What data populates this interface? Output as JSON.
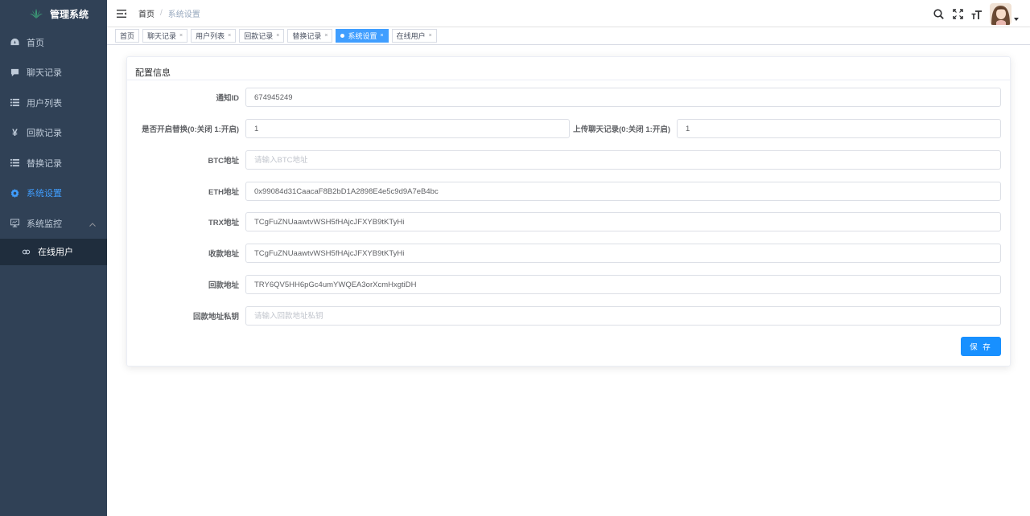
{
  "app": {
    "title": "管理系统"
  },
  "sidebar": {
    "items": [
      {
        "label": "首页",
        "icon": "dashboard-icon"
      },
      {
        "label": "聊天记录",
        "icon": "message-icon"
      },
      {
        "label": "用户列表",
        "icon": "list-icon"
      },
      {
        "label": "回款记录",
        "icon": "yen-icon"
      },
      {
        "label": "替换记录",
        "icon": "list-icon"
      },
      {
        "label": "系统设置",
        "icon": "gear-icon",
        "active": true
      },
      {
        "label": "系统监控",
        "icon": "monitor-icon",
        "expanded": true
      }
    ],
    "submenu": [
      {
        "label": "在线用户",
        "icon": "online-icon"
      }
    ]
  },
  "header": {
    "breadcrumb": {
      "home": "首页",
      "separator": "/",
      "current": "系统设置"
    }
  },
  "tags": [
    {
      "label": "首页",
      "closable": false
    },
    {
      "label": "聊天记录",
      "closable": true
    },
    {
      "label": "用户列表",
      "closable": true
    },
    {
      "label": "回款记录",
      "closable": true
    },
    {
      "label": "替换记录",
      "closable": true
    },
    {
      "label": "系统设置",
      "closable": true,
      "active": true
    },
    {
      "label": "在线用户",
      "closable": true
    }
  ],
  "form": {
    "title": "配置信息",
    "notify_id": {
      "label": "通知ID",
      "value": "674945249"
    },
    "enable_replace": {
      "label": "是否开启替换(0:关闭 1:开启)",
      "value": "1"
    },
    "upload_chat": {
      "label": "上传聊天记录(0:关闭 1:开启)",
      "value": "1"
    },
    "btc": {
      "label": "BTC地址",
      "value": "",
      "placeholder": "请输入BTC地址"
    },
    "eth": {
      "label": "ETH地址",
      "value": "0x99084d31CaacaF8B2bD1A2898E4e5c9d9A7eB4bc"
    },
    "trx": {
      "label": "TRX地址",
      "value": "TCgFuZNUaawtvWSH5fHAjcJFXYB9tKTyHi"
    },
    "receive": {
      "label": "收款地址",
      "value": "TCgFuZNUaawtvWSH5fHAjcJFXYB9tKTyHi"
    },
    "payback": {
      "label": "回款地址",
      "value": "TRY6QV5HH6pGc4umYWQEA3orXcmHxgtiDH"
    },
    "payback_key": {
      "label": "回款地址私钥",
      "value": "",
      "placeholder": "请输入回款地址私钥"
    },
    "save_label": "保 存"
  },
  "colors": {
    "sidebar_bg": "#304156",
    "submenu_bg": "#1f2d3d",
    "accent": "#409eff",
    "button": "#1890ff"
  },
  "close_glyph": "×"
}
